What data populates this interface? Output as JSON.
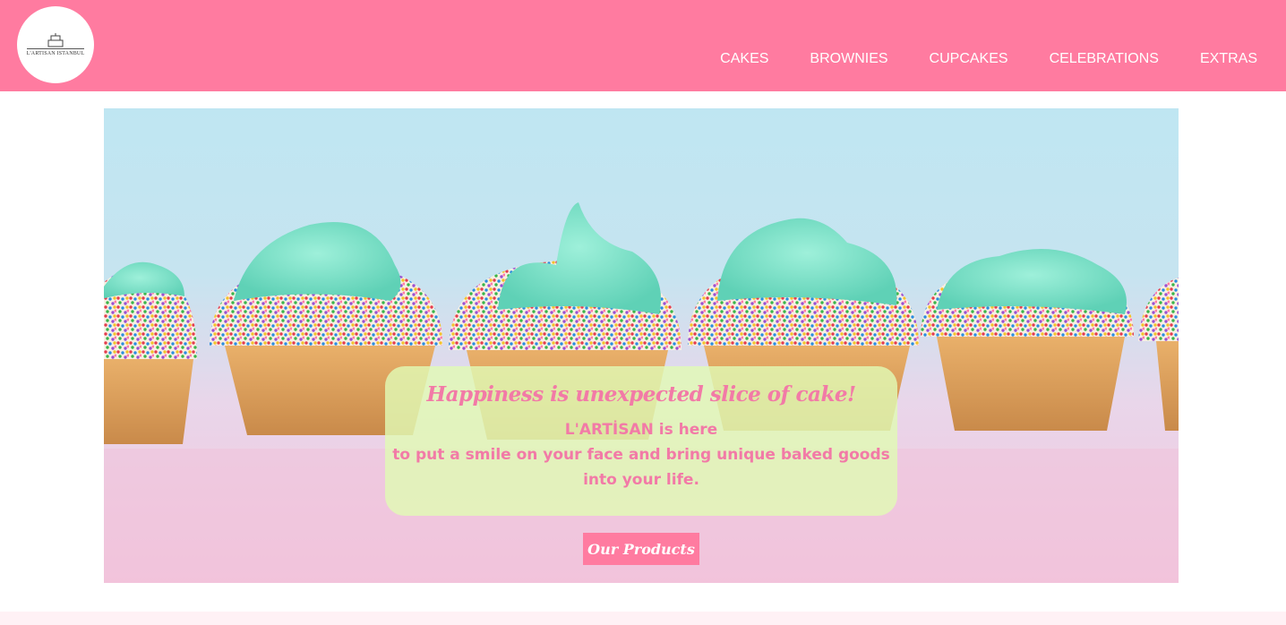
{
  "brand": {
    "logo_text": "L'ARTISAN ISTANBUL"
  },
  "nav": {
    "items": [
      {
        "label": "CAKES"
      },
      {
        "label": "BROWNIES"
      },
      {
        "label": "CUPCAKES"
      },
      {
        "label": "CELEBRATIONS"
      },
      {
        "label": "EXTRAS"
      }
    ]
  },
  "hero": {
    "tagline": "Happiness is unexpected slice of cake!",
    "line1": "L'ARTİSAN is here",
    "line2": "to put a smile on your face and bring unique baked goods",
    "line3": "into your life.",
    "button_label": "Our Products"
  },
  "colors": {
    "nav_bg": "#ff7ba0",
    "accent_pink": "#f27aa7",
    "frosting": "#7fe0c8",
    "highlight_box": "#e0fab4"
  },
  "icons": {
    "logo": "cake-icon"
  }
}
